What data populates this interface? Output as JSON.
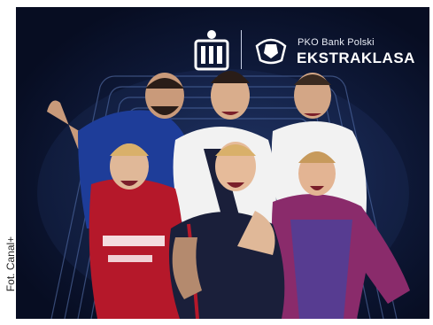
{
  "credit": "Fot. Canal+",
  "logo": {
    "brand_small": "PKO Bank Polski",
    "brand_big": "EKSTRAKLASA",
    "mark_icon": "pko-bank-logo",
    "ball_icon": "ekstraklasa-ball-logo"
  },
  "colors": {
    "background": "#0f1a3a",
    "track_lines": "#5f7bb8",
    "jersey_red": "#b5182a",
    "jersey_white": "#f2f2f2",
    "jersey_blue": "#1e3d99",
    "jersey_navy": "#1a1f3a",
    "jersey_purple_red": "#8a2b6b"
  },
  "players": [
    {
      "id": "top-left",
      "jersey": "blue"
    },
    {
      "id": "top-center",
      "jersey": "white"
    },
    {
      "id": "top-right",
      "jersey": "white"
    },
    {
      "id": "bottom-left",
      "jersey": "red"
    },
    {
      "id": "bottom-center",
      "jersey": "navy"
    },
    {
      "id": "bottom-right",
      "jersey": "purple-red"
    }
  ]
}
